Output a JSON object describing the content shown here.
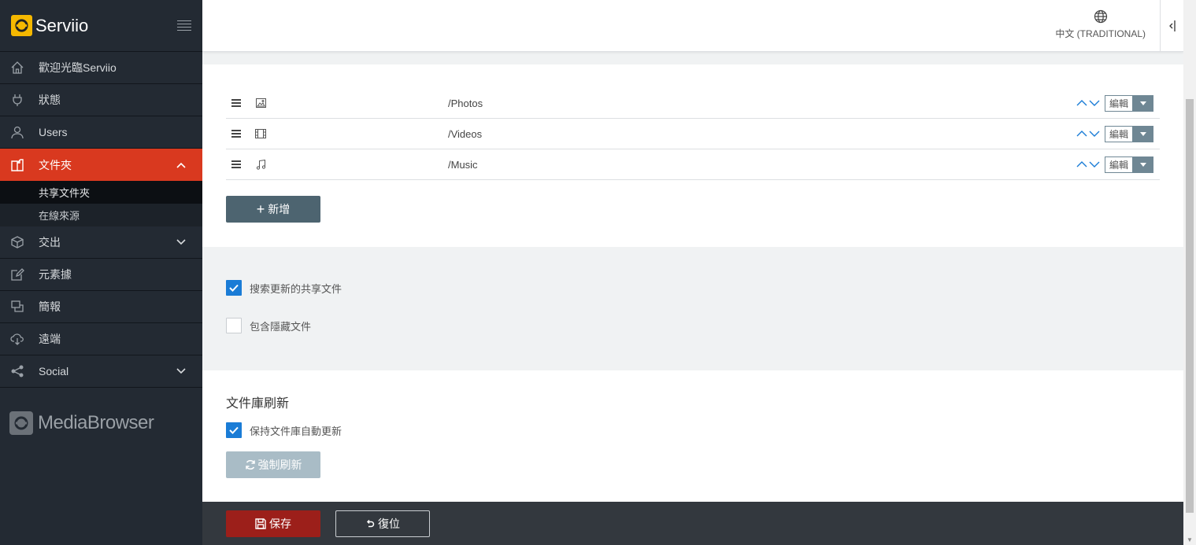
{
  "brand": {
    "name": "Serviio"
  },
  "nav": {
    "welcome": "歡迎光臨Serviio",
    "status": "狀態",
    "users": "Users",
    "folders": "文件夾",
    "folders_sub": [
      "共享文件夾",
      "在線來源"
    ],
    "delivery": "交出",
    "metadata": "元素據",
    "presentation": "簡報",
    "remote": "遠端",
    "social": "Social"
  },
  "mediabrowser": {
    "label": "MediaBrowser"
  },
  "topbar": {
    "language": "中文 (TRADITIONAL)"
  },
  "shared_folders": [
    {
      "type": "photo-icon",
      "path": "/Photos",
      "edit_label": "編輯"
    },
    {
      "type": "film-icon",
      "path": "/Videos",
      "edit_label": "編輯"
    },
    {
      "type": "music-icon",
      "path": "/Music",
      "edit_label": "編輯"
    }
  ],
  "add_button": {
    "label": "新增"
  },
  "options": {
    "search_updates": {
      "label": "搜索更新的共享文件",
      "checked": true
    },
    "include_hidden": {
      "label": "包含隱藏文件",
      "checked": false
    }
  },
  "library_refresh": {
    "title": "文件庫刷新",
    "auto_update": {
      "label": "保持文件庫自動更新",
      "checked": true
    },
    "force_refresh_label": "強制刷新"
  },
  "footer": {
    "save_label": "保存",
    "reset_label": "復位"
  },
  "colors": {
    "accent": "#d9391f",
    "check": "#1a7cd6",
    "save": "#9c1f1a",
    "button": "#4d6470"
  }
}
